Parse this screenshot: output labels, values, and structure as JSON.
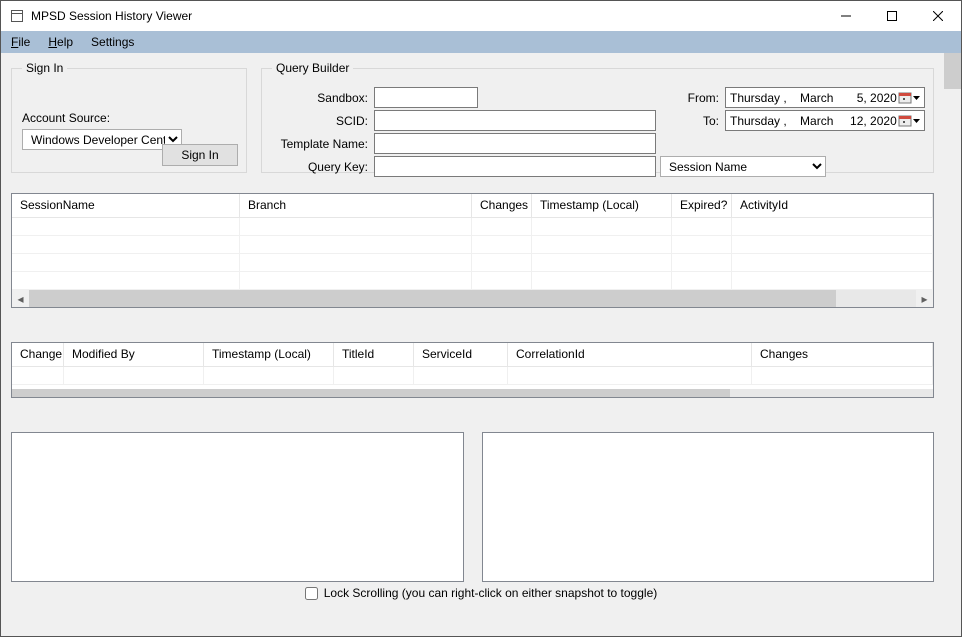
{
  "window": {
    "title": "MPSD Session History Viewer"
  },
  "menu": {
    "file": "File",
    "help": "Help",
    "settings": "Settings"
  },
  "signin": {
    "legend": "Sign In",
    "account_source_label": "Account Source:",
    "account_source_value": "Windows Developer Center",
    "button": "Sign In"
  },
  "query": {
    "legend": "Query Builder",
    "sandbox_label": "Sandbox:",
    "scid_label": "SCID:",
    "template_label": "Template Name:",
    "key_label": "Query Key:",
    "key_type": "Session Name",
    "from_label": "From:",
    "to_label": "To:",
    "from_value": "Thursday ,    March       5, 2020",
    "to_value": "Thursday ,    March     12, 2020",
    "sandbox_value": "",
    "scid_value": "",
    "template_value": "",
    "key_value": ""
  },
  "grid1": {
    "cols": [
      "SessionName",
      "Branch",
      "Changes",
      "Timestamp (Local)",
      "Expired?",
      "ActivityId"
    ]
  },
  "grid2": {
    "cols": [
      "Change",
      "Modified By",
      "Timestamp (Local)",
      "TitleId",
      "ServiceId",
      "CorrelationId",
      "Changes"
    ]
  },
  "footer": {
    "lock": "Lock Scrolling (you can right-click on either snapshot to toggle)"
  }
}
